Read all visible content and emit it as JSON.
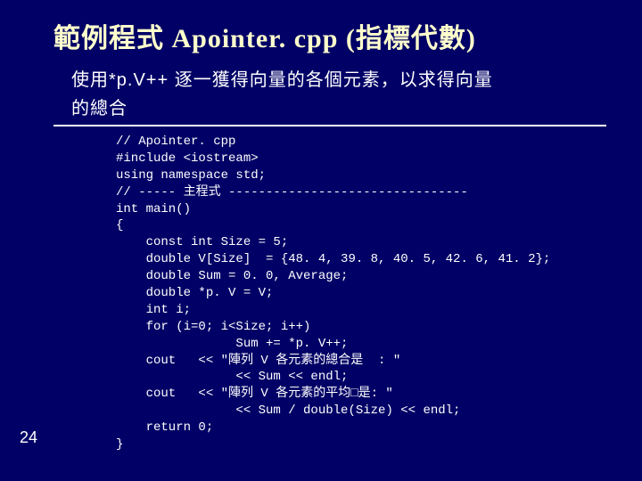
{
  "title": "範例程式  Apointer. cpp (指標代數)",
  "subtitle_line1": "使用*p.V++ 逐一獲得向量的各個元素，以求得向量",
  "subtitle_line2": "的總合",
  "code": {
    "l01": "// Apointer. cpp",
    "l02": "#include <iostream>",
    "l03": "using namespace std;",
    "l04": "// ----- 主程式 --------------------------------",
    "l05": "int main()",
    "l06": "{",
    "l07": "    const int Size = 5;",
    "l08": "    double V[Size]  = {48. 4, 39. 8, 40. 5, 42. 6, 41. 2};",
    "l09": "    double Sum = 0. 0, Average;",
    "l10": "    double *p. V = V;",
    "l11": "    int i;",
    "l12": "    for (i=0; i<Size; i++)",
    "l13": "                Sum += *p. V++;",
    "l14": "    cout   << \"陣列 V 各元素的總合是  : \"",
    "l15": "                << Sum << endl;",
    "l16": "    cout   << \"陣列 V 各元素的平均□是: \"",
    "l17": "                << Sum / double(Size) << endl;",
    "l18": "    return 0;",
    "l19": "}"
  },
  "page_num": "24"
}
